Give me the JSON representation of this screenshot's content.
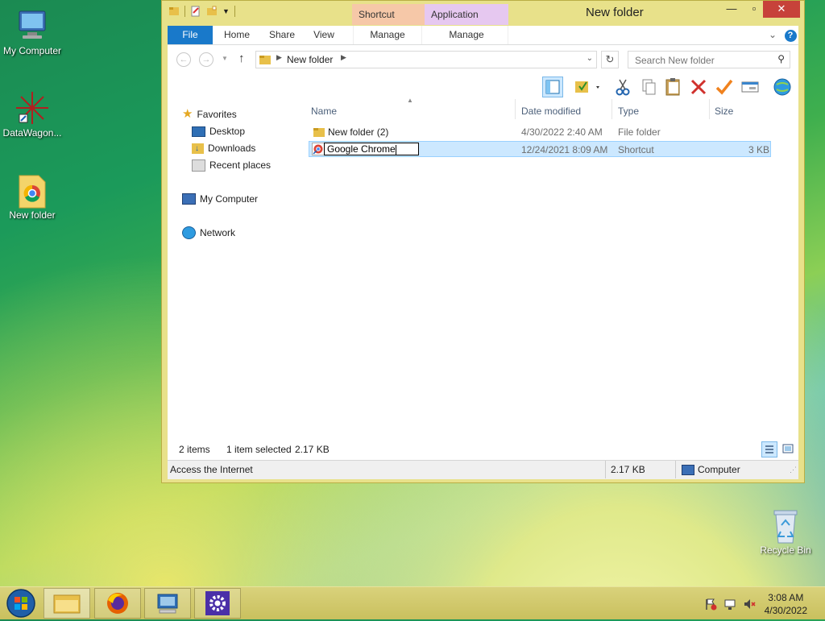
{
  "desktop": {
    "icons": [
      {
        "label": "My Computer"
      },
      {
        "label": "DataWagon..."
      },
      {
        "label": "New folder"
      },
      {
        "label": "Recycle Bin"
      }
    ]
  },
  "window": {
    "title": "New folder",
    "context_tabs": {
      "shortcut_tools": "Shortcut Tools",
      "application_tools": "Application Tools"
    },
    "ribbon_tabs": [
      "File",
      "Home",
      "Share",
      "View",
      "Manage",
      "Manage"
    ],
    "address": {
      "path_segment": "New folder"
    },
    "search": {
      "placeholder": "Search New folder"
    },
    "nav": {
      "favorites": "Favorites",
      "desktop": "Desktop",
      "downloads": "Downloads",
      "recent": "Recent places",
      "computer": "My Computer",
      "network": "Network"
    },
    "columns": {
      "name": "Name",
      "date": "Date modified",
      "type": "Type",
      "size": "Size"
    },
    "files": [
      {
        "name": "New folder (2)",
        "date": "4/30/2022 2:40 AM",
        "type": "File folder",
        "size": ""
      },
      {
        "name": "Google Chrome",
        "date": "12/24/2021 8:09 AM",
        "type": "Shortcut",
        "size": "3 KB"
      }
    ],
    "status": {
      "count": "2 items",
      "selected": "1 item selected",
      "selected_size": "2.17 KB"
    },
    "details": {
      "description": "Access the Internet",
      "size": "2.17 KB",
      "location": "Computer"
    }
  },
  "taskbar": {
    "clock_time": "3:08 AM",
    "clock_date": "4/30/2022"
  },
  "colors": {
    "accent": "#1979ca",
    "selection": "#cce8ff",
    "close": "#c7423a",
    "frame": "#e8e18a"
  }
}
